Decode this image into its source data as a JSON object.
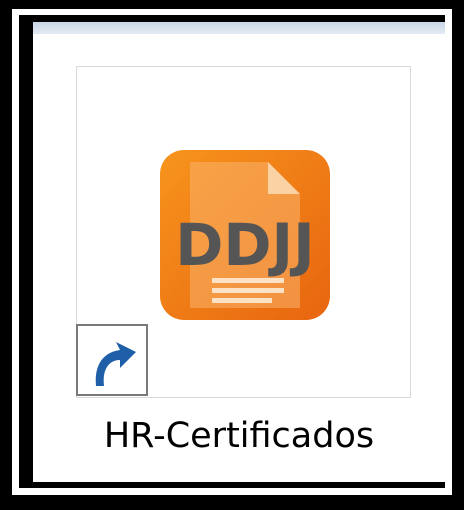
{
  "desktop_shortcut": {
    "label": "HR-Certificados",
    "icon": "ddjj-document-app-icon",
    "icon_text": "DDJJ",
    "badge": "shortcut-arrow-icon",
    "colors": {
      "icon_orange": "#f58220",
      "icon_orange_dark": "#e8650f",
      "text_gray": "#555555",
      "badge_blue": "#1f5fa8"
    }
  }
}
